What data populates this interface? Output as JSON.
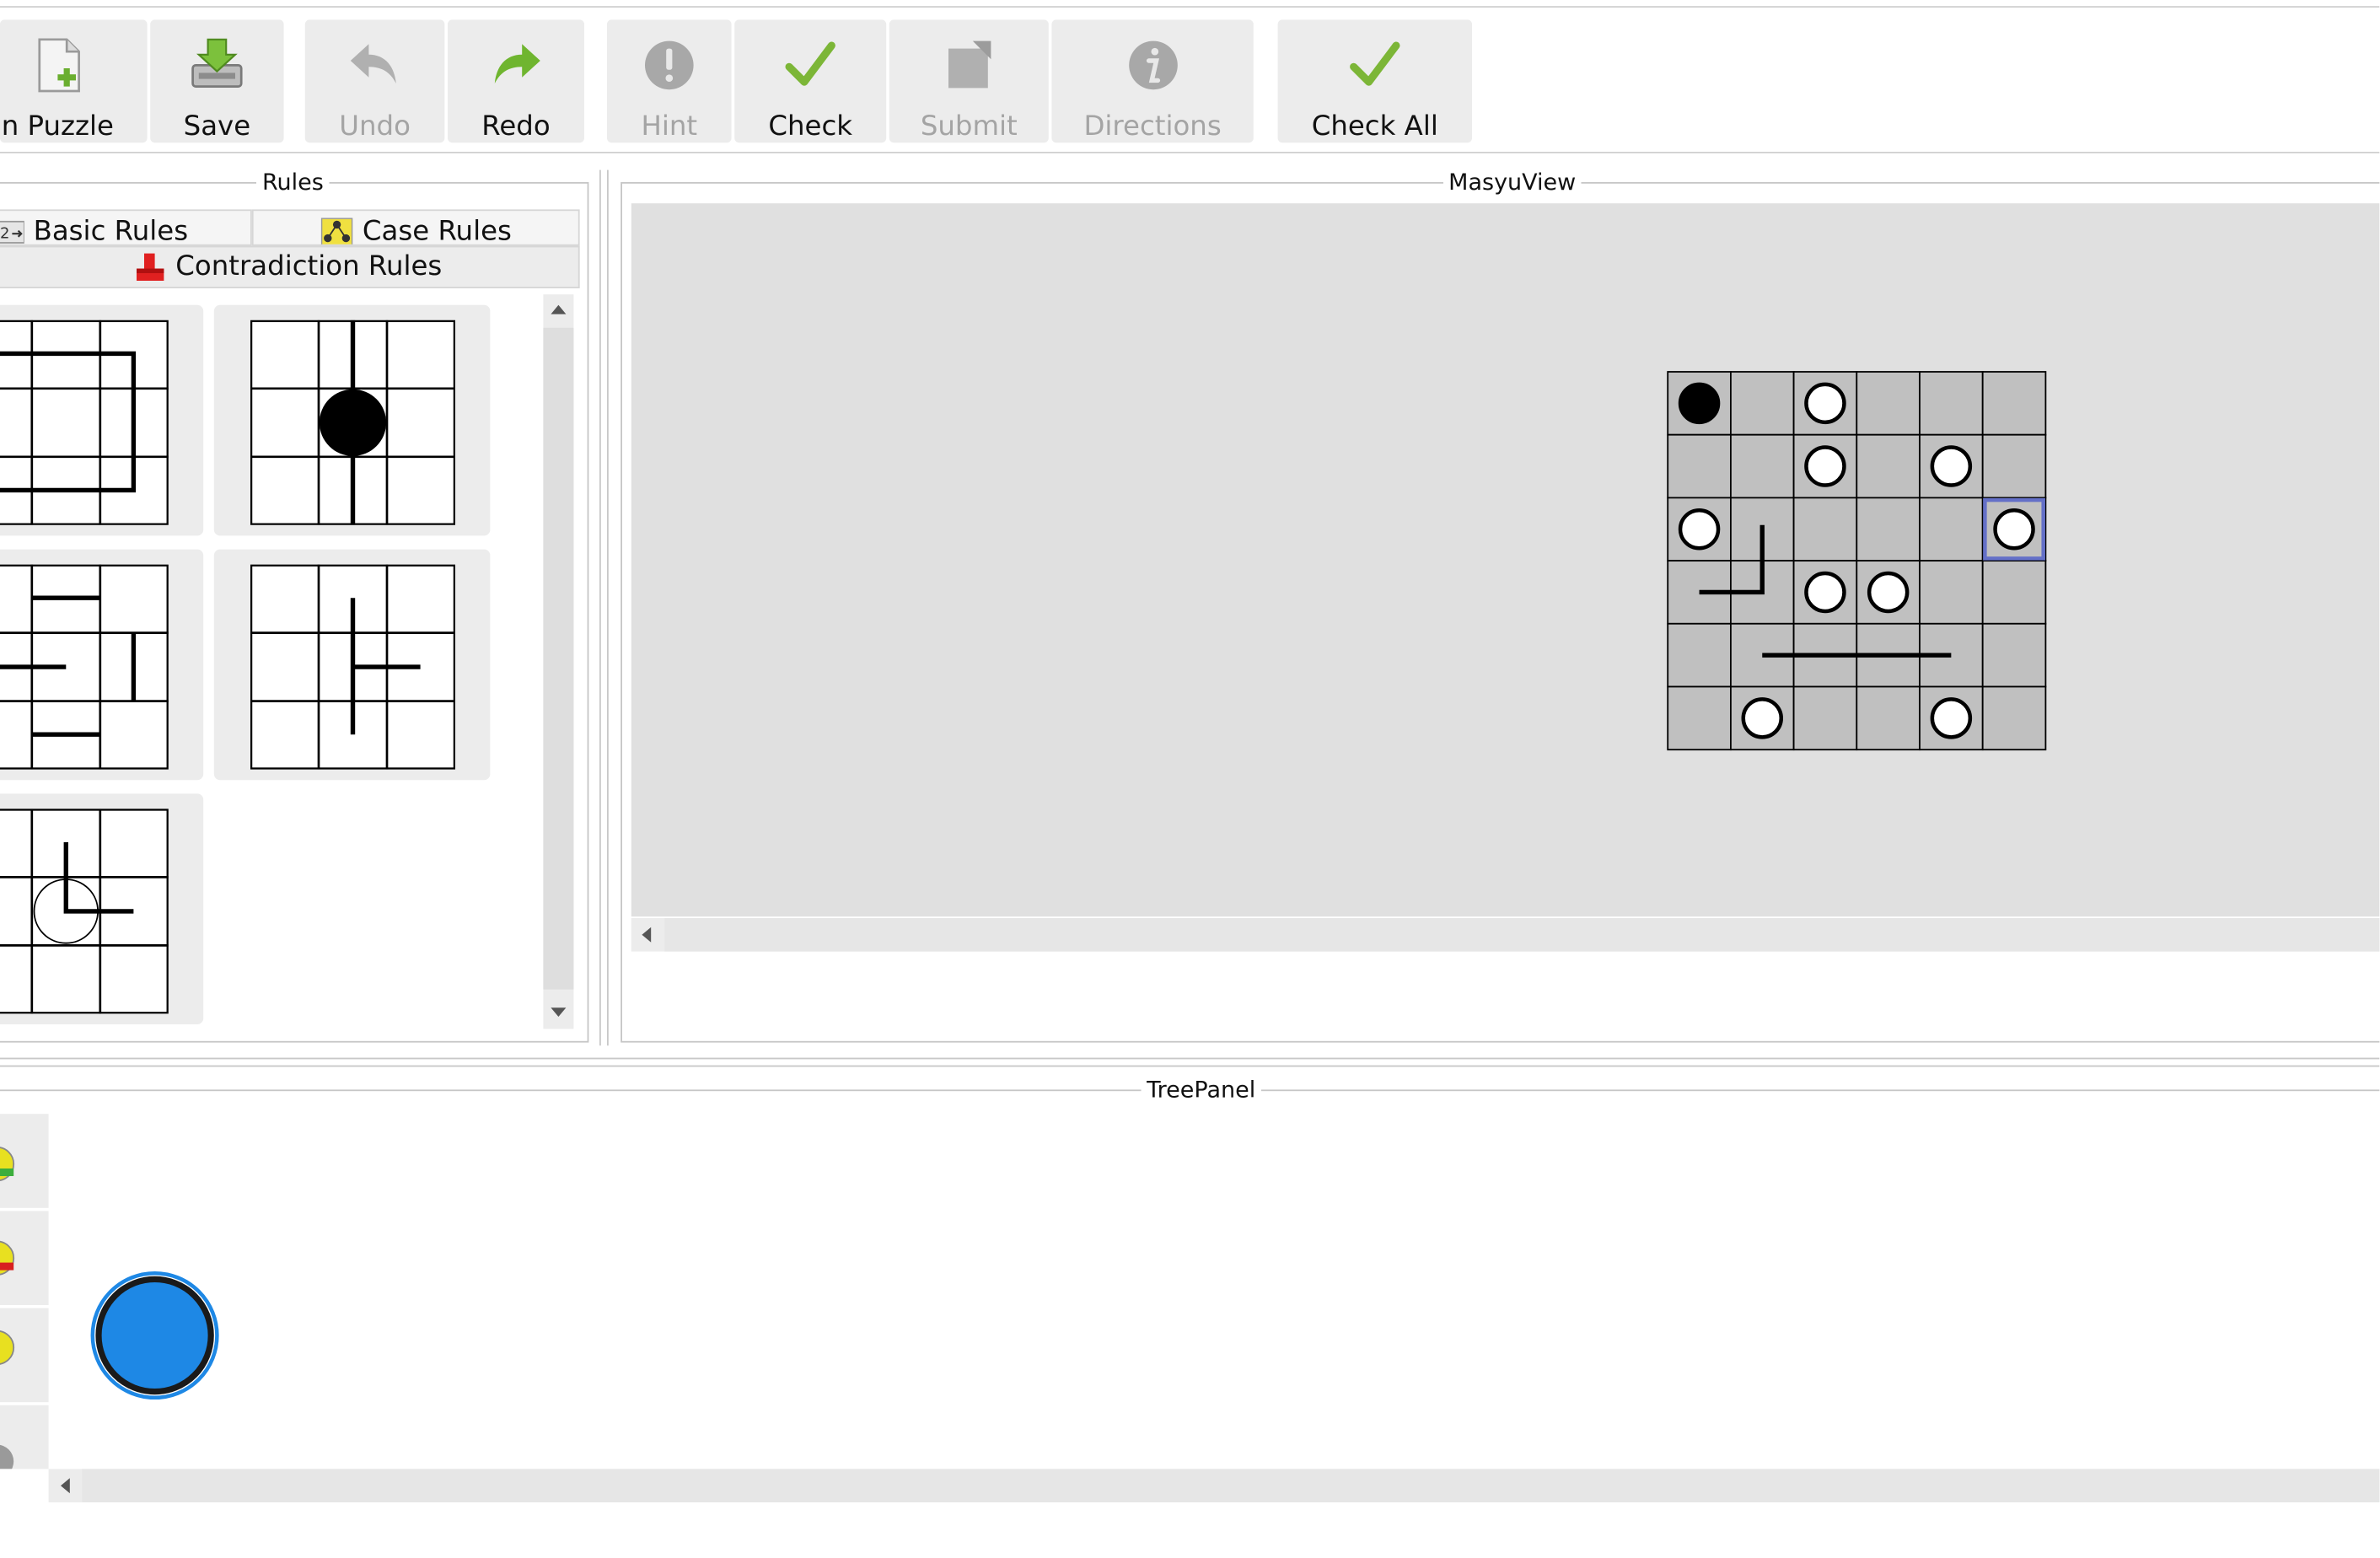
{
  "toolbar": {
    "open_puzzle": "n Puzzle",
    "save": "Save",
    "undo": "Undo",
    "redo": "Redo",
    "hint": "Hint",
    "check": "Check",
    "submit": "Submit",
    "directions": "Directions",
    "check_all": "Check All"
  },
  "rules_panel": {
    "title": "Rules",
    "tabs": {
      "basic": "Basic Rules",
      "case": "Case Rules",
      "contradiction": "Contradiction Rules"
    },
    "selected_tab": "Contradiction Rules",
    "rule_card_count": 5
  },
  "puzzle_view": {
    "title": "MasyuView",
    "grid": {
      "rows": 6,
      "cols": 6,
      "cells": [
        [
          "black",
          "",
          "white",
          "",
          "",
          ""
        ],
        [
          "",
          "",
          "white",
          "",
          "white",
          ""
        ],
        [
          "white",
          "",
          "",
          "",
          "",
          "white"
        ],
        [
          "",
          "",
          "white",
          "white",
          "",
          ""
        ],
        [
          "",
          "",
          "",
          "",
          "",
          ""
        ],
        [
          "",
          "white",
          "",
          "",
          "white",
          ""
        ]
      ],
      "selected_cell": [
        2,
        5
      ]
    }
  },
  "tree_panel": {
    "title": "TreePanel",
    "node_count": 1
  },
  "colors": {
    "button_bg": "#ececec",
    "disabled_text": "#a4a4a4",
    "puzzle_cell": "#c0c0c0",
    "canvas_bg": "#e0e0e0",
    "tree_node": "#1e88e5",
    "selection": "#6470c8",
    "check_green": "#7cb637",
    "contradiction_red": "#e02020"
  }
}
